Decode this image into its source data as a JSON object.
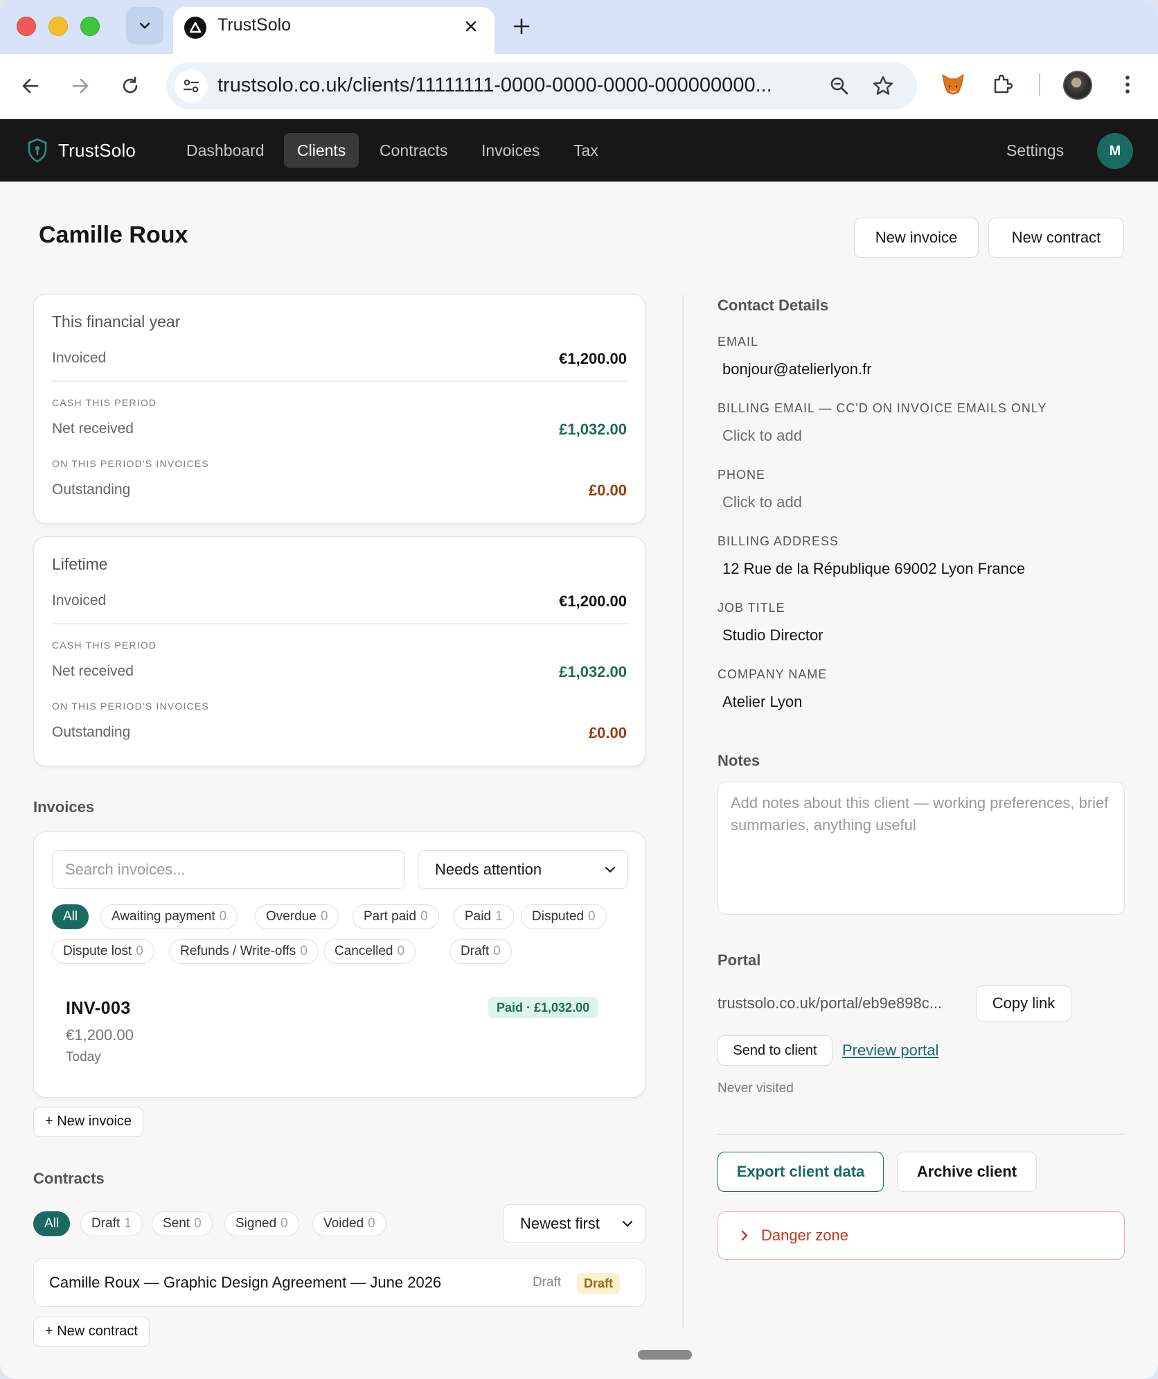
{
  "browser": {
    "tab_title": "TrustSolo",
    "url": "trustsolo.co.uk/clients/11111111-0000-0000-0000-000000000..."
  },
  "nav": {
    "brand": "TrustSolo",
    "links": [
      "Dashboard",
      "Clients",
      "Contracts",
      "Invoices",
      "Tax"
    ],
    "active_link": "Clients",
    "settings": "Settings",
    "avatar_initial": "M"
  },
  "header": {
    "client_name": "Camille Roux",
    "new_invoice": "New invoice",
    "new_contract": "New contract"
  },
  "summary_cards": [
    {
      "title": "This financial year",
      "invoiced_label": "Invoiced",
      "invoiced_value": "€1,200.00",
      "cash_label": "CASH THIS PERIOD",
      "net_label": "Net received",
      "net_value": "£1,032.00",
      "period_label": "ON THIS PERIOD'S INVOICES",
      "outstanding_label": "Outstanding",
      "outstanding_value": "£0.00"
    },
    {
      "title": "Lifetime",
      "invoiced_label": "Invoiced",
      "invoiced_value": "€1,200.00",
      "cash_label": "CASH THIS PERIOD",
      "net_label": "Net received",
      "net_value": "£1,032.00",
      "period_label": "ON THIS PERIOD'S INVOICES",
      "outstanding_label": "Outstanding",
      "outstanding_value": "£0.00"
    }
  ],
  "invoices": {
    "heading": "Invoices",
    "search_placeholder": "Search invoices...",
    "filter_select": "Needs attention",
    "chips": [
      {
        "label": "All",
        "count": ""
      },
      {
        "label": "Awaiting payment",
        "count": "0"
      },
      {
        "label": "Overdue",
        "count": "0"
      },
      {
        "label": "Part paid",
        "count": "0"
      },
      {
        "label": "Paid",
        "count": "1"
      },
      {
        "label": "Disputed",
        "count": "0"
      },
      {
        "label": "Dispute lost",
        "count": "0"
      },
      {
        "label": "Refunds / Write-offs",
        "count": "0"
      },
      {
        "label": "Cancelled",
        "count": "0"
      },
      {
        "label": "Draft",
        "count": "0"
      }
    ],
    "items": [
      {
        "number": "INV-003",
        "amount": "€1,200.00",
        "date": "Today",
        "status": "Paid · £1,032.00"
      }
    ],
    "add_button": "+ New invoice"
  },
  "contracts": {
    "heading": "Contracts",
    "chips": [
      {
        "label": "All",
        "count": ""
      },
      {
        "label": "Draft",
        "count": "1"
      },
      {
        "label": "Sent",
        "count": "0"
      },
      {
        "label": "Signed",
        "count": "0"
      },
      {
        "label": "Voided",
        "count": "0"
      }
    ],
    "sort_select": "Newest first",
    "items": [
      {
        "title": "Camille Roux — Graphic Design Agreement — June 2026",
        "status": "Draft",
        "badge": "Draft"
      }
    ],
    "add_button": "+ New contract"
  },
  "contact": {
    "heading": "Contact Details",
    "fields": [
      {
        "label": "EMAIL",
        "value": "bonjour@atelierlyon.fr"
      },
      {
        "label": "BILLING EMAIL — CC'D ON INVOICE EMAILS ONLY",
        "value": "Click to add"
      },
      {
        "label": "PHONE",
        "value": "Click to add"
      },
      {
        "label": "BILLING ADDRESS",
        "value": "12 Rue de la République 69002 Lyon France"
      },
      {
        "label": "JOB TITLE",
        "value": "Studio Director"
      },
      {
        "label": "COMPANY NAME",
        "value": "Atelier Lyon"
      }
    ]
  },
  "notes": {
    "heading": "Notes",
    "placeholder": "Add notes about this client — working preferences, brief summaries, anything useful"
  },
  "portal": {
    "heading": "Portal",
    "link": "trustsolo.co.uk/portal/eb9e898c...",
    "copy_button": "Copy link",
    "send_button": "Send to client",
    "preview_link": "Preview portal",
    "visited": "Never visited"
  },
  "actions": {
    "export": "Export client data",
    "archive": "Archive client",
    "danger": "Danger zone"
  },
  "colors": {
    "accent": "#1b6a62",
    "net_received": "#1d6b5a",
    "outstanding": "#9a3e12",
    "danger": "#c8321e",
    "appbar": "#171717"
  }
}
